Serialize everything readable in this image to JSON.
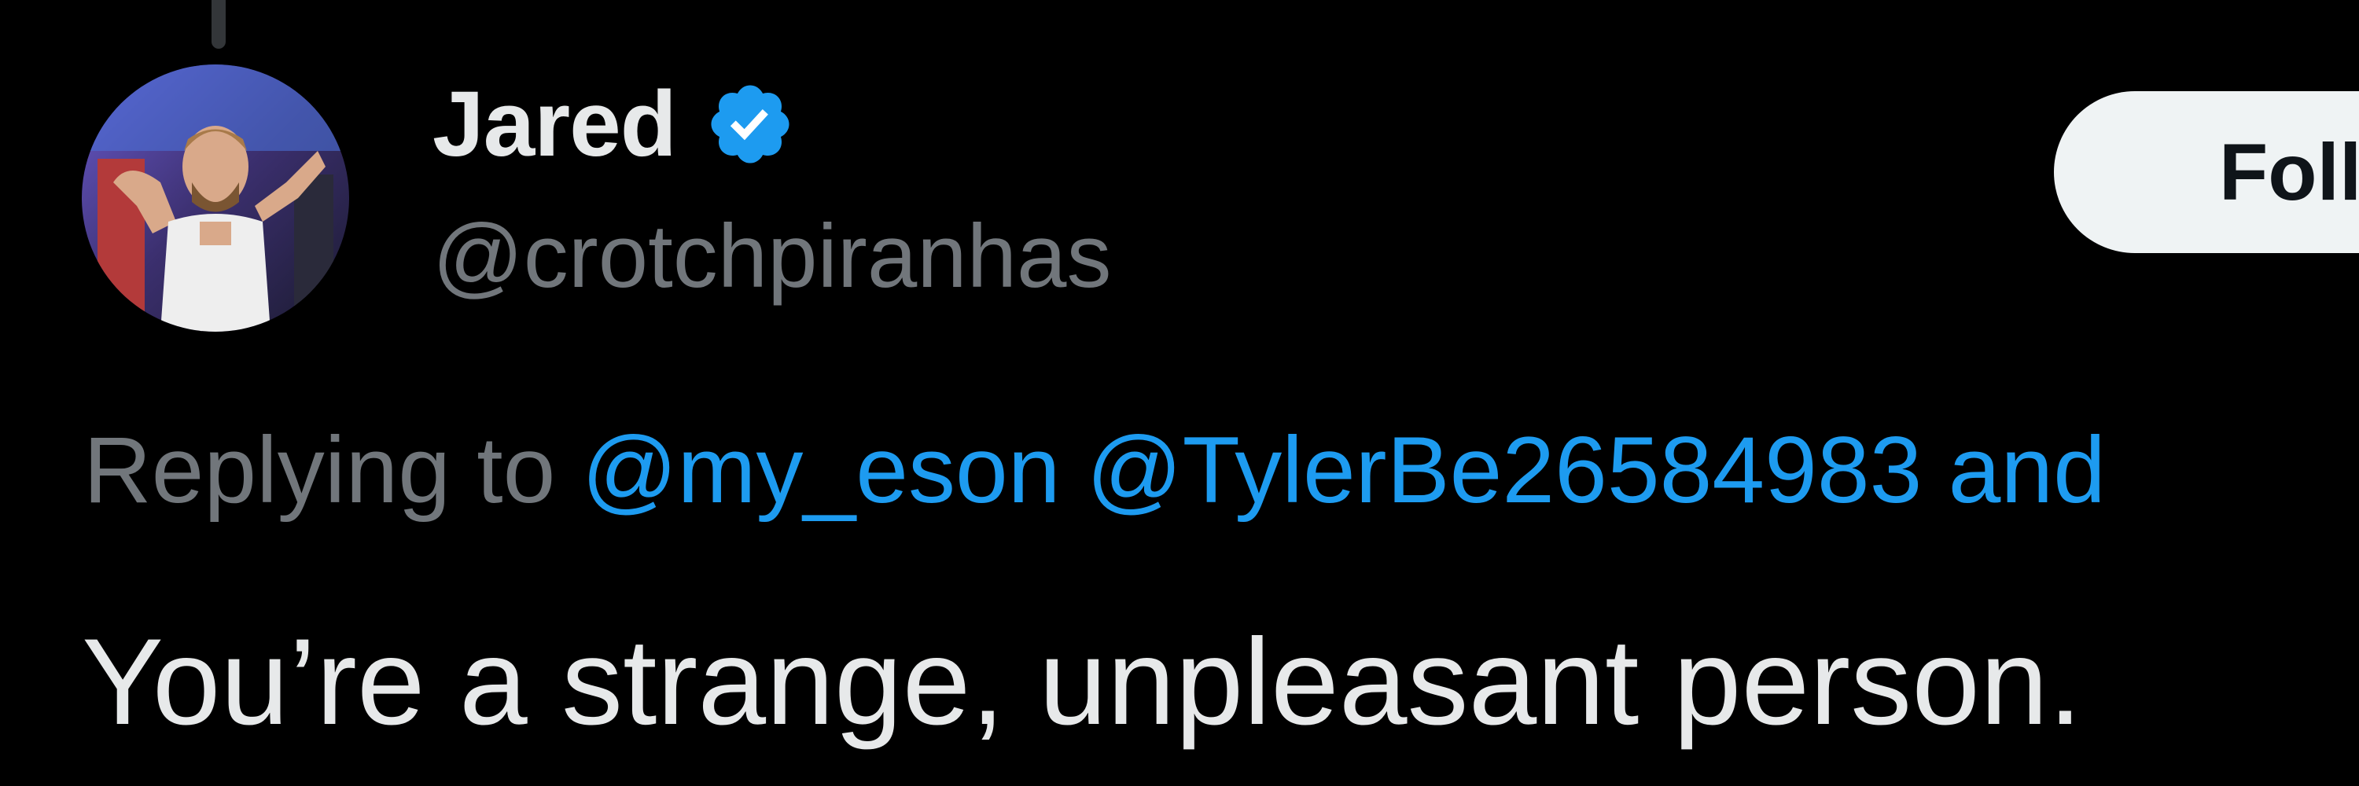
{
  "tweet": {
    "author": {
      "display_name": "Jared",
      "handle": "@crotchpiranhas",
      "verified": true,
      "avatar_icon": "profile-photo"
    },
    "follow_button_label": "Follow",
    "replying_to": {
      "prefix": "Replying to",
      "mentions": [
        "@my_eson",
        "@TylerBe26584983"
      ],
      "suffix": "and"
    },
    "text": "You’re a strange, unpleasant person."
  },
  "colors": {
    "background": "#000000",
    "primary_text": "#e7e9ea",
    "secondary_text": "#71767b",
    "link": "#1d9bf0",
    "verified_badge": "#1d9bf0",
    "follow_button_bg": "#eff3f4"
  }
}
